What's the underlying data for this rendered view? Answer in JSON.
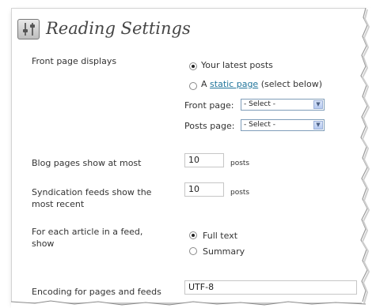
{
  "page": {
    "title": "Reading Settings",
    "title_icon": "settings-sliders-icon"
  },
  "front_page": {
    "label": "Front page displays",
    "options": [
      {
        "label": "Your latest posts",
        "checked": true
      },
      {
        "prefix": "A ",
        "link": "static page",
        "suffix": " (select below)",
        "checked": false
      }
    ],
    "front_page_label": "Front page:",
    "front_page_value": "- Select -",
    "posts_page_label": "Posts page:",
    "posts_page_value": "- Select -"
  },
  "blog_pages": {
    "label": "Blog pages show at most",
    "value": "10",
    "unit": "posts"
  },
  "syndication": {
    "label_line1": "Syndication feeds show the",
    "label_line2": "most recent",
    "value": "10",
    "unit": "posts"
  },
  "feed_article": {
    "label_line1": "For each article in a feed,",
    "label_line2": "show",
    "options": [
      {
        "label": "Full text",
        "checked": true
      },
      {
        "label": "Summary",
        "checked": false
      }
    ]
  },
  "encoding": {
    "label": "Encoding for pages and feeds",
    "value": "UTF-8"
  }
}
